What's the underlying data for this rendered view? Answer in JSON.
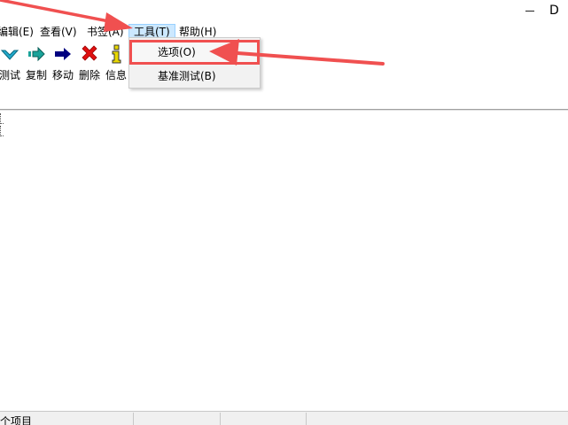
{
  "window": {
    "title_fragment": "D"
  },
  "menubar": {
    "items": [
      {
        "label": "编辑(E)",
        "id": "edit"
      },
      {
        "label": "查看(V)",
        "id": "view"
      },
      {
        "label": "书签(A)",
        "id": "bookmarks"
      },
      {
        "label": "工具(T)",
        "id": "tools",
        "active": true
      },
      {
        "label": "帮助(H)",
        "id": "help"
      }
    ]
  },
  "toolbar": {
    "buttons": [
      {
        "label": "测试",
        "icon": "test-check-icon"
      },
      {
        "label": "复制",
        "icon": "copy-arrow-icon"
      },
      {
        "label": "移动",
        "icon": "move-arrow-icon"
      },
      {
        "label": "删除",
        "icon": "delete-x-icon"
      },
      {
        "label": "信息",
        "icon": "info-icon"
      }
    ]
  },
  "tools_menu": {
    "items": [
      {
        "label": "选项(O)",
        "highlighted": true
      },
      {
        "label": "基准测试(B)"
      }
    ]
  },
  "statusbar": {
    "text": "个项目"
  },
  "colors": {
    "accent_highlight": "#f05050",
    "menu_active_bg": "#cce8ff",
    "copy_icon": "#1aa39a",
    "move_icon": "#000080",
    "delete_icon": "#e01010",
    "info_icon": "#e8d800",
    "test_icon": "#22aacc"
  }
}
